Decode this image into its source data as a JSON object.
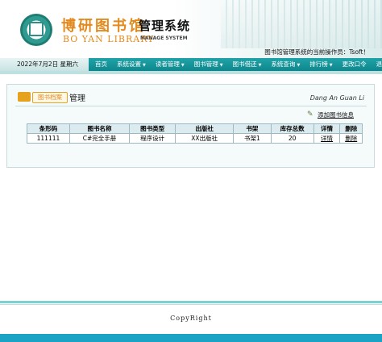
{
  "header": {
    "brand_cn": "博研图书馆",
    "brand_cn_suffix": "管理系统",
    "brand_en": "BO YAN LIBRARY",
    "brand_en_suffix": "MANAGE SYSTEM",
    "operator_text": "图书馆管理系统的当前操作员：Tsoft！"
  },
  "nav": {
    "date": "2022年7月2日  星期六",
    "items": [
      {
        "label": "首页",
        "arrow": false
      },
      {
        "label": "系统设置",
        "arrow": true
      },
      {
        "label": "读者管理",
        "arrow": true
      },
      {
        "label": "图书管理",
        "arrow": true
      },
      {
        "label": "图书借还",
        "arrow": true
      },
      {
        "label": "系统查询",
        "arrow": true
      },
      {
        "label": "排行榜",
        "arrow": true
      },
      {
        "label": "更改口令",
        "arrow": false
      },
      {
        "label": "退出系统",
        "arrow": false
      }
    ]
  },
  "panel": {
    "title_pill": "图书档案",
    "title": "管理",
    "title_en": "Dang An Guan Li",
    "add_link": "添加图书信息"
  },
  "table": {
    "headers": [
      "条形码",
      "图书名称",
      "图书类型",
      "出版社",
      "书架",
      "库存总数",
      "详情",
      "删除"
    ],
    "rows": [
      [
        "111111",
        "C#完全手册",
        "程序设计",
        "XX出版社",
        "书架1",
        "20",
        "详情",
        "删除"
      ]
    ]
  },
  "footer": {
    "copyright": "CopyRight"
  },
  "colors": {
    "nav": "#1fa3a8",
    "accent": "#e38a1e",
    "footer_bar": "#1aa3c5"
  }
}
